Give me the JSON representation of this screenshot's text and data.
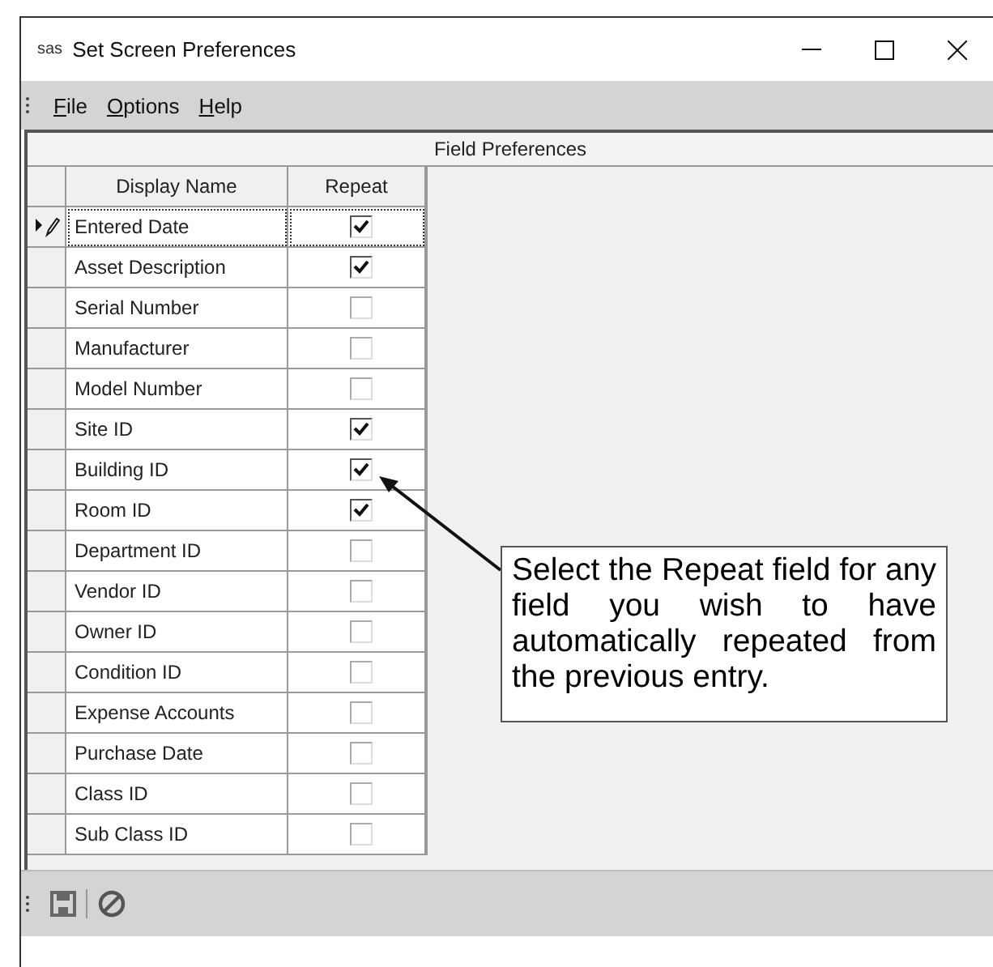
{
  "window": {
    "title": "Set Screen Preferences",
    "logo": "sas"
  },
  "menu": [
    "File",
    "Options",
    "Help"
  ],
  "panel": {
    "title": "Field Preferences"
  },
  "table": {
    "columns": [
      "Display Name",
      "Repeat"
    ],
    "rows": [
      {
        "name": "Entered Date",
        "repeat": true,
        "selected": true
      },
      {
        "name": "Asset Description",
        "repeat": true,
        "selected": false
      },
      {
        "name": "Serial Number",
        "repeat": false,
        "selected": false
      },
      {
        "name": "Manufacturer",
        "repeat": false,
        "selected": false
      },
      {
        "name": "Model Number",
        "repeat": false,
        "selected": false
      },
      {
        "name": "Site ID",
        "repeat": true,
        "selected": false
      },
      {
        "name": "Building ID",
        "repeat": true,
        "selected": false
      },
      {
        "name": "Room ID",
        "repeat": true,
        "selected": false
      },
      {
        "name": "Department ID",
        "repeat": false,
        "selected": false
      },
      {
        "name": "Vendor ID",
        "repeat": false,
        "selected": false
      },
      {
        "name": "Owner ID",
        "repeat": false,
        "selected": false
      },
      {
        "name": "Condition ID",
        "repeat": false,
        "selected": false
      },
      {
        "name": "Expense Accounts",
        "repeat": false,
        "selected": false
      },
      {
        "name": "Purchase Date",
        "repeat": false,
        "selected": false
      },
      {
        "name": "Class ID",
        "repeat": false,
        "selected": false
      },
      {
        "name": "Sub Class ID",
        "repeat": false,
        "selected": false
      }
    ]
  },
  "callout": {
    "text": "Select the Repeat field for any field you wish to have automatically repeated from the previous entry."
  }
}
